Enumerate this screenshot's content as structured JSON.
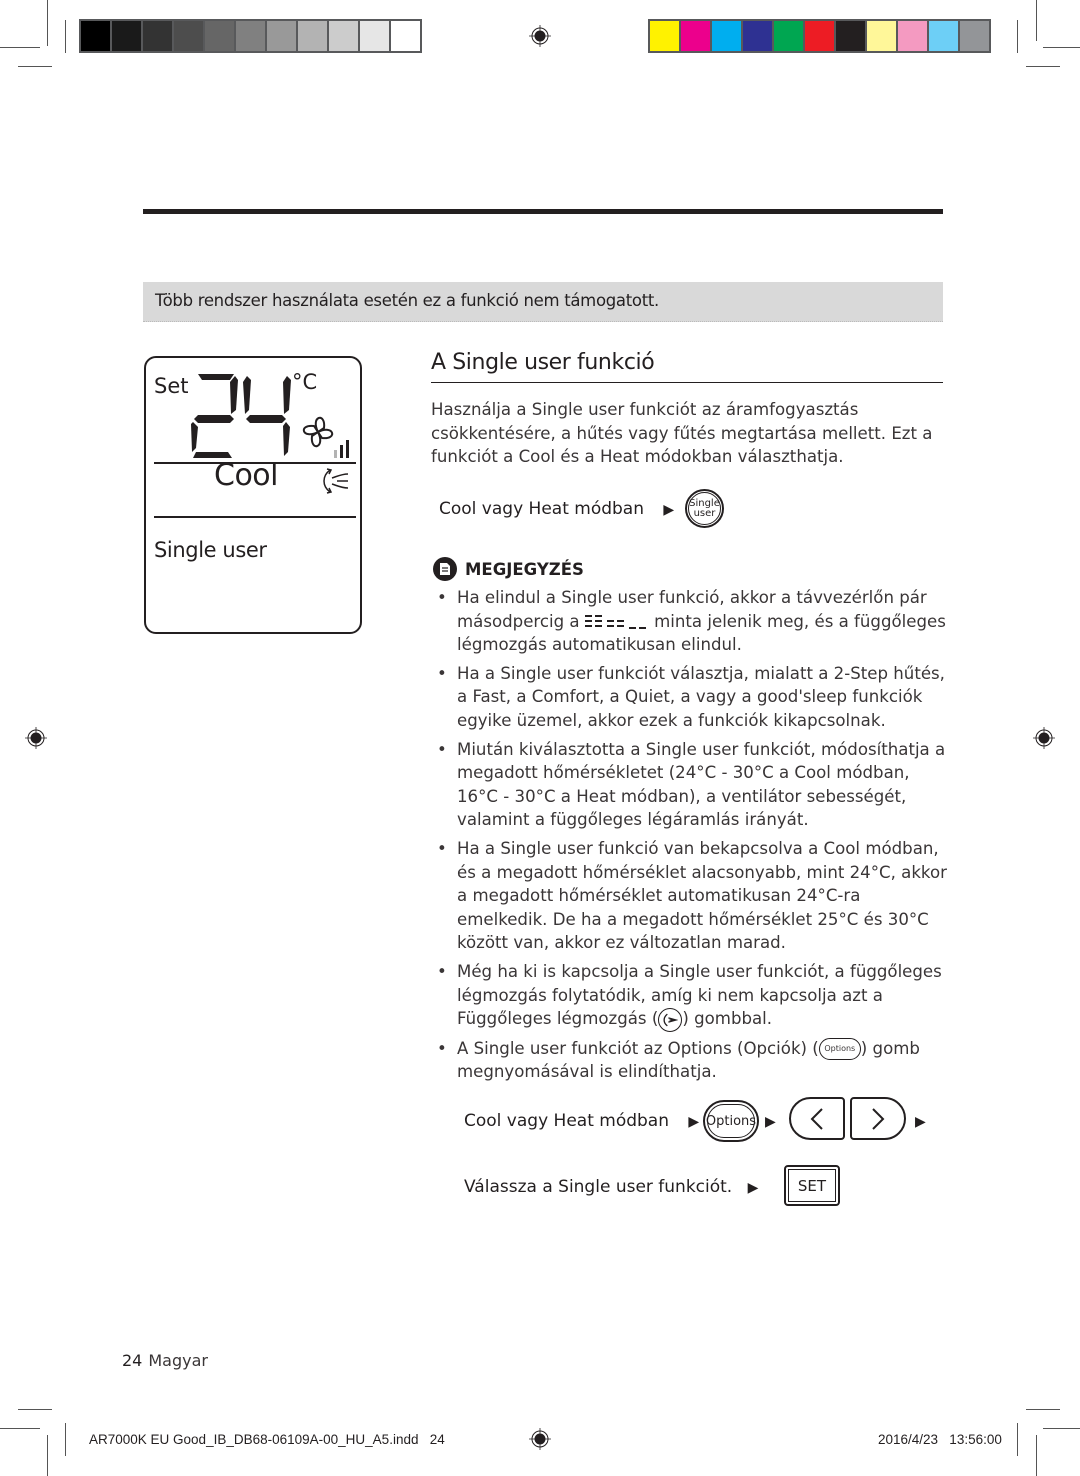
{
  "print_marks": {
    "gray_swatches": [
      "#000000",
      "#1a1a1a",
      "#333333",
      "#4d4d4d",
      "#666666",
      "#808080",
      "#999999",
      "#b3b3b3",
      "#cccccc",
      "#e6e6e6",
      "#ffffff"
    ],
    "color_swatches": [
      "#fff200",
      "#ec008c",
      "#00aeef",
      "#2e3192",
      "#00a651",
      "#ed1c24",
      "#231f20",
      "#fff799",
      "#f49ac1",
      "#6dcff6",
      "#939598"
    ]
  },
  "notice": "Több rendszer használata esetén ez a funkció nem támogatott.",
  "lcd": {
    "set_label": "Set",
    "temperature": "24",
    "unit": "°C",
    "mode": "Cool",
    "function": "Single user",
    "fan_level_bars": 3
  },
  "section": {
    "title": "A Single user funkció",
    "intro": "Használja a Single user funkciót az áramfogyasztás csökkentésére, a hűtés vagy fűtés megtartása mellett. Ezt a funkciót a Cool és a Heat módokban választhatja.",
    "step1_label": "Cool vagy Heat módban",
    "single_user_btn_line1": "Single",
    "single_user_btn_line2": "user"
  },
  "note": {
    "heading": "MEGJEGYZÉS",
    "b1_part1": "Ha elindul a Single user funkció, akkor a távvezérlőn pár másodpercig a ",
    "b1_part2": " minta jelenik meg, és a függőleges légmozgás automatikusan elindul.",
    "b2": "Ha a Single user funkciót választja, mialatt a 2-Step hűtés, a Fast, a Comfort, a Quiet, a vagy a good'sleep funkciók egyike üzemel, akkor ezek a funkciók kikapcsolnak.",
    "b3": "Miután kiválasztotta a Single user funkciót, módosíthatja a megadott hőmérsékletet (24°C - 30°C a Cool módban, 16°C - 30°C a Heat módban), a ventilátor sebességét, valamint a függőleges légáramlás irányát.",
    "b4": "Ha a Single user funkció van bekapcsolva a Cool módban, és a megadott hőmérséklet alacsonyabb, mint 24°C, akkor a megadott hőmérséklet automatikusan 24°C-ra emelkedik. De ha a megadott hőmérséklet 25°C és 30°C között van, akkor ez változatlan marad.",
    "b5_part1": "Még ha ki is kapcsolja a Single user funkciót, a függőleges légmozgás folytatódik, amíg ki nem kapcsolja azt a Függőleges légmozgás (",
    "b5_part2": ") gombbal.",
    "b6_part1": "A Single user funkciót az Options (Opciók) (",
    "b6_part2": ") gomb megnyomásával is elindíthatja.",
    "options_small": "Options"
  },
  "procedure": {
    "step1_label": "Cool vagy Heat módban",
    "options_label": "Options",
    "left_label": "<",
    "right_label": ">",
    "step2_label": "Válassza a Single user funkciót.",
    "set_label": "SET",
    "arrow": "▶"
  },
  "footer": {
    "page_number": "24",
    "language": "Magyar",
    "slug_file": "AR7000K EU Good_IB_DB68-06109A-00_HU_A5.indd   24",
    "slug_date": "2016/4/23   13:56:00"
  }
}
